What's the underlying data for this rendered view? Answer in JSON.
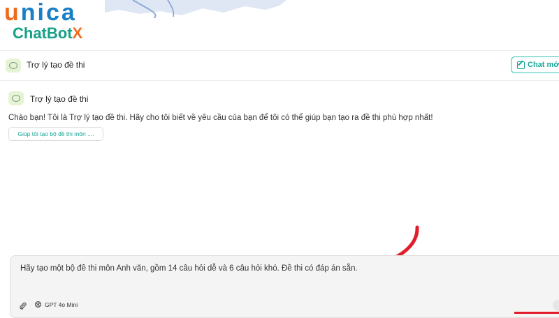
{
  "brand": {
    "logo_u": "u",
    "logo_rest": "nica",
    "logo_chatbot": "ChatBot",
    "logo_x": "X",
    "colors": {
      "orange": "#ef6c1f",
      "blue": "#1b7fc4",
      "green": "#16a085"
    }
  },
  "header": {
    "title": "Trợ lý tạo đề thi",
    "icon": "chat-bubble-icon",
    "new_chat_label": "Chat mới"
  },
  "assistant": {
    "name": "Trợ lý tạo đề thi",
    "greeting": "Chào bạn! Tôi là Trợ lý tạo đề thi. Hãy cho tôi biết về yêu cầu của bạn để tôi có thể giúp bạn tạo ra đề thi phù hợp nhất!",
    "suggestion": "Giúp tôi tạo bộ đề thi môn ...."
  },
  "composer": {
    "value": "Hãy tạo một bộ đề thi môn Anh văn, gồm 14 câu hỏi dễ và 6 câu hỏi khó. Đề thi có đáp án sẵn.",
    "model_label": "GPT 4o Mini",
    "icons": [
      "paperclip-icon",
      "openai-icon",
      "send-icon"
    ]
  },
  "accent_colors": {
    "teal": "#17a596",
    "annotation_red": "#e11d2a"
  }
}
